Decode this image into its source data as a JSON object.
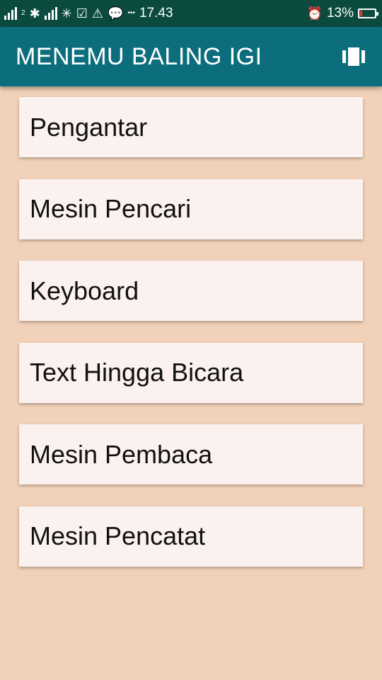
{
  "status_bar": {
    "time": "17.43",
    "battery_percent": "13%",
    "sim_label": "2",
    "notification_icons": [
      "signal-icon",
      "network-icon",
      "signal-icon",
      "app-icon",
      "bag-check-icon",
      "warning-icon",
      "line-icon"
    ],
    "more_dots": "•••",
    "alarm_icon": "⏰",
    "battery_level": 0.13
  },
  "app_bar": {
    "title": "MENEMU BALING IGI",
    "menu_icon": "view-carousel-icon"
  },
  "menu": {
    "items": [
      {
        "label": "Pengantar"
      },
      {
        "label": "Mesin Pencari"
      },
      {
        "label": "Keyboard"
      },
      {
        "label": "Text Hingga Bicara"
      },
      {
        "label": "Mesin Pembaca"
      },
      {
        "label": "Mesin Pencatat"
      }
    ]
  },
  "colors": {
    "status_bar": "#0b4a3e",
    "app_bar": "#0c6e7c",
    "background": "#f1d1b8",
    "card": "#fbf1ee",
    "battery_low": "#e53935"
  }
}
